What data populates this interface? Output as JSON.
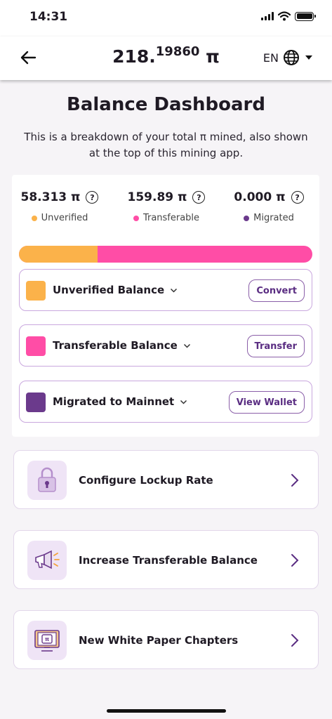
{
  "status_bar": {
    "time": "14:31"
  },
  "header": {
    "balance_int": "218.",
    "balance_decimal": "19860",
    "balance_symbol": "π",
    "language": "EN"
  },
  "title": "Balance Dashboard",
  "description": "This is a breakdown of your total π mined, also shown at the top of this mining app.",
  "stats": [
    {
      "value": "58.313 π",
      "label": "Unverified",
      "color": "#fbb24a"
    },
    {
      "value": "159.89 π",
      "label": "Transferable",
      "color": "#ff4da6"
    },
    {
      "value": "0.000 π",
      "label": "Migrated",
      "color": "#6b3a8c"
    }
  ],
  "progress": {
    "unverified_fraction": 0.268,
    "transferable_fraction": 0.732,
    "migrated_fraction": 0.0
  },
  "balance_rows": [
    {
      "label": "Unverified Balance",
      "button": "Convert",
      "color": "#fbb24a"
    },
    {
      "label": "Transferable Balance",
      "button": "Transfer",
      "color": "#ff4da6"
    },
    {
      "label": "Migrated to Mainnet",
      "button": "View Wallet",
      "color": "#6b3a8c"
    }
  ],
  "cards": [
    {
      "label": "Configure Lockup Rate",
      "icon": "lock-icon"
    },
    {
      "label": "Increase Transferable Balance",
      "icon": "megaphone-icon"
    },
    {
      "label": "New White Paper Chapters",
      "icon": "whitepaper-icon"
    }
  ]
}
